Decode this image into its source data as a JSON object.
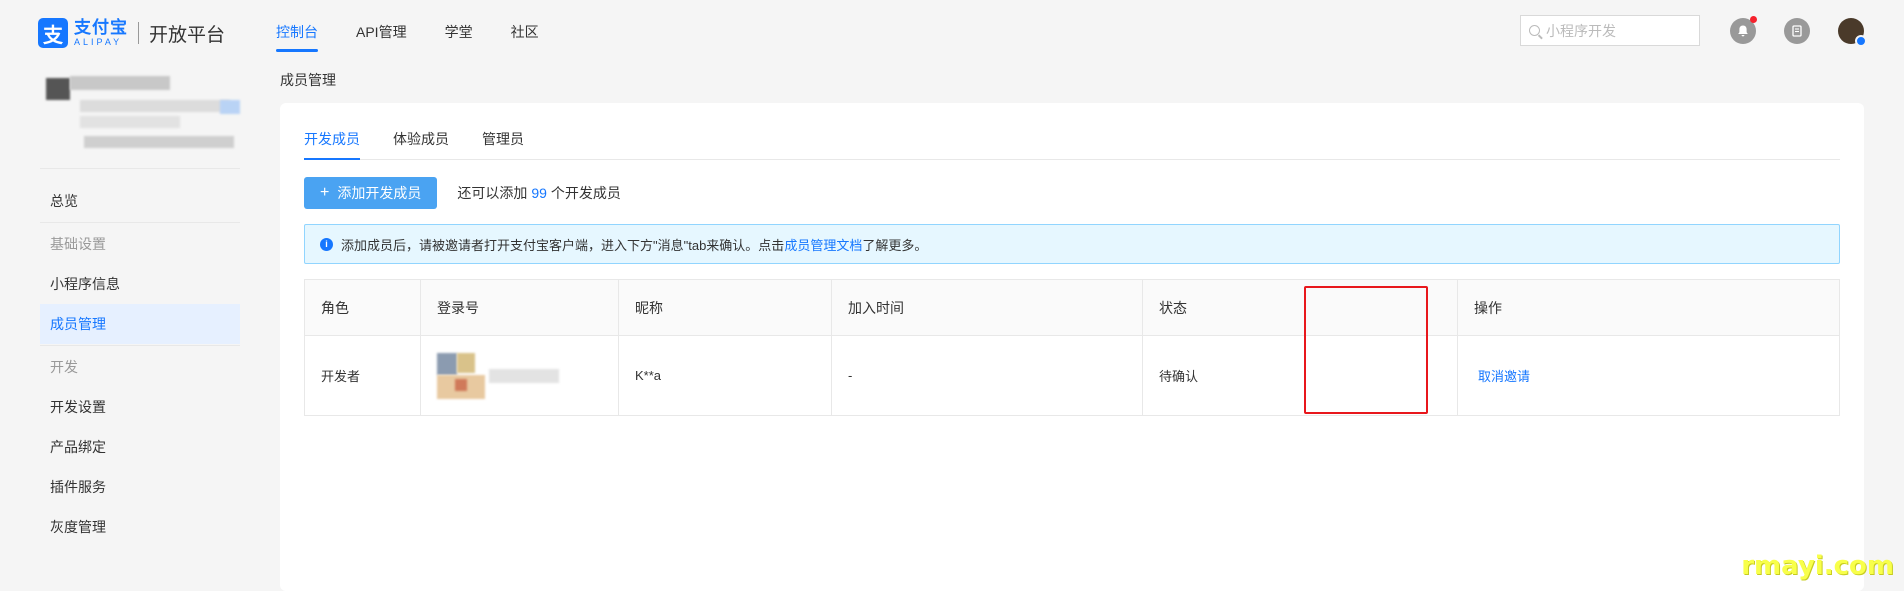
{
  "header": {
    "logo_cn": "支付宝",
    "logo_en": "ALIPAY",
    "platform": "开放平台",
    "nav": [
      "控制台",
      "API管理",
      "学堂",
      "社区"
    ],
    "search_placeholder": "小程序开发"
  },
  "sidebar": {
    "items": [
      {
        "label": "总览",
        "type": "item"
      },
      {
        "label": "基础设置",
        "type": "group"
      },
      {
        "label": "小程序信息",
        "type": "item"
      },
      {
        "label": "成员管理",
        "type": "item",
        "active": true
      },
      {
        "label": "开发",
        "type": "group"
      },
      {
        "label": "开发设置",
        "type": "item"
      },
      {
        "label": "产品绑定",
        "type": "item"
      },
      {
        "label": "插件服务",
        "type": "item"
      },
      {
        "label": "灰度管理",
        "type": "item"
      }
    ]
  },
  "breadcrumb": "成员管理",
  "tabs": [
    "开发成员",
    "体验成员",
    "管理员"
  ],
  "add_button": "添加开发成员",
  "quota": {
    "prefix": "还可以添加",
    "count": "99",
    "suffix": "个开发成员"
  },
  "alert": {
    "text_before": "添加成员后，请被邀请者打开支付宝客户端，进入下方\"消息\"tab来确认。点击",
    "link": "成员管理文档",
    "text_after": "了解更多。"
  },
  "table": {
    "headers": [
      "角色",
      "登录号",
      "昵称",
      "加入时间",
      "状态",
      "操作"
    ],
    "rows": [
      {
        "role": "开发者",
        "login": "",
        "nickname": "K**a",
        "joined": "-",
        "status": "待确认",
        "action": "取消邀请"
      }
    ]
  },
  "watermark": "rmayi.com",
  "colors": {
    "accent": "#1677ff",
    "highlight": "#e8171c",
    "button": "#4aa3f2"
  }
}
